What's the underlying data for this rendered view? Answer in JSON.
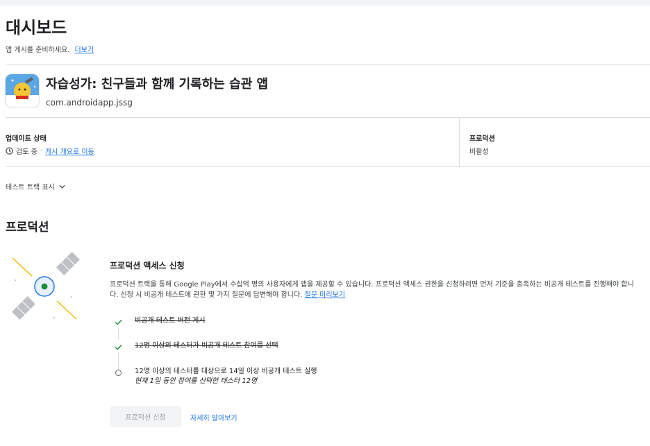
{
  "page": {
    "title": "대시보드",
    "subtitle": "앱 게시를 준비하세요.",
    "more_link": "더보기"
  },
  "app": {
    "name": "자습성가: 친구들과 함께 기록하는 습관 앱",
    "package": "com.androidapp.jssg"
  },
  "status": {
    "update_label": "업데이트 상태",
    "update_value": "검토 중",
    "overview_link": "게시 개요로 이동",
    "production_label": "프로덕션",
    "production_value": "비활성"
  },
  "track_toggle": "테스트 트랙 표시",
  "production": {
    "section_title": "프로덕션",
    "card_title": "프로덕션 액세스 신청",
    "description": "프로덕션 트랙을 통해 Google Play에서 수십억 명의 사용자에게 앱을 제공할 수 있습니다. 프로덕션 액세스 권한을 신청하려면 먼저 기준을 충족하는 비공개 테스트를 진행해야 합니다. 신청 시 비공개 테스트에 관한 몇 가지 질문에 답변해야 합니다.",
    "preview_link": "질문 미리보기",
    "requirements": [
      {
        "text": "비공개 테스트 버전 게시",
        "done": true
      },
      {
        "text": "12명 이상의 테스터가 비공개 테스트 참여를 선택",
        "done": true
      },
      {
        "text": "12명 이상의 테스터를 대상으로 14일 이상 비공개 테스트 실행",
        "done": false,
        "sub": "현재 1일 동안 참여를 선택한 테스터 12명"
      }
    ],
    "apply_button": "프로덕션 신청",
    "learn_more": "자세히 알아보기"
  },
  "colors": {
    "accent": "#1a73e8",
    "check": "#1e8e3e",
    "divider": "#dadce0"
  }
}
